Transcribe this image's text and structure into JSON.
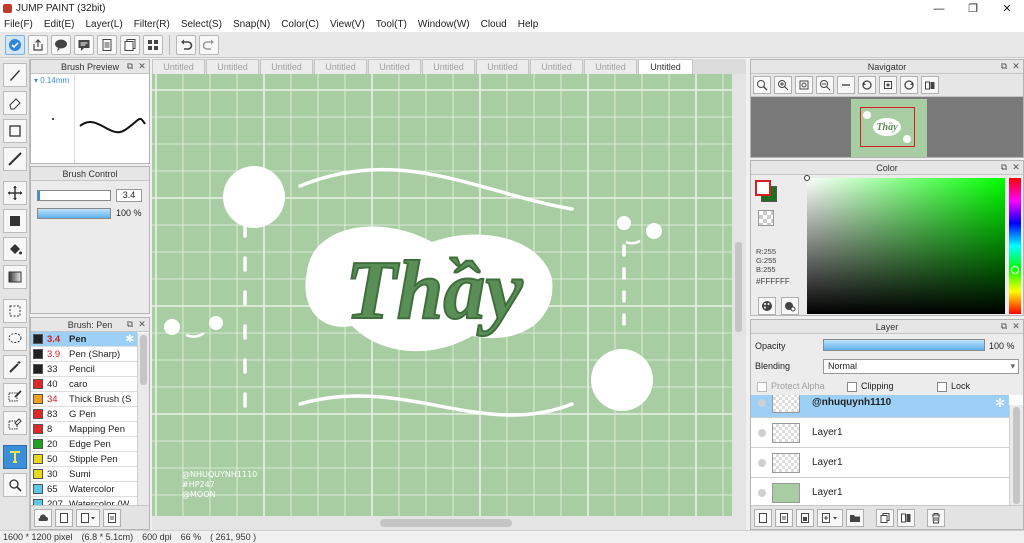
{
  "window": {
    "title": "JUMP PAINT (32bit)",
    "minimize": "—",
    "maximize": "❐",
    "close": "✕"
  },
  "menu": [
    "File(F)",
    "Edit(E)",
    "Layer(L)",
    "Filter(R)",
    "Select(S)",
    "Snap(N)",
    "Color(C)",
    "View(V)",
    "Tool(T)",
    "Window(W)",
    "Cloud",
    "Help"
  ],
  "brush_preview": {
    "title": "Brush Preview",
    "size_label": "0.14mm"
  },
  "brush_control": {
    "title": "Brush Control",
    "size_value": "3.4",
    "opacity_value": "100 %",
    "opacity_fill": 1.0
  },
  "brush_list": {
    "title": "Brush: Pen",
    "items": [
      {
        "size": "3.4",
        "name": "Pen",
        "color": "#222222",
        "size_red": true,
        "selected": true
      },
      {
        "size": "3.9",
        "name": "Pen (Sharp)",
        "color": "#222222",
        "size_red": true,
        "selected": false
      },
      {
        "size": "33",
        "name": "Pencil",
        "color": "#222222",
        "size_red": false,
        "selected": false
      },
      {
        "size": "40",
        "name": "caro",
        "color": "#e02828",
        "size_red": false,
        "selected": false
      },
      {
        "size": "34",
        "name": "Thick Brush (S",
        "color": "#f0a020",
        "size_red": true,
        "selected": false
      },
      {
        "size": "83",
        "name": "G Pen",
        "color": "#e02828",
        "size_red": false,
        "selected": false
      },
      {
        "size": "8",
        "name": "Mapping Pen",
        "color": "#e02828",
        "size_red": false,
        "selected": false
      },
      {
        "size": "20",
        "name": "Edge Pen",
        "color": "#22a022",
        "size_red": false,
        "selected": false
      },
      {
        "size": "50",
        "name": "Stipple Pen",
        "color": "#e8d820",
        "size_red": false,
        "selected": false
      },
      {
        "size": "30",
        "name": "Sumi",
        "color": "#e8d820",
        "size_red": false,
        "selected": false
      },
      {
        "size": "65",
        "name": "Watercolor",
        "color": "#5ac8e8",
        "size_red": false,
        "selected": false
      },
      {
        "size": "207",
        "name": "Watercolor (W",
        "color": "#5ac8e8",
        "size_red": false,
        "selected": false
      }
    ]
  },
  "tabs": [
    "Untitled",
    "Untitled",
    "Untitled",
    "Untitled",
    "Untitled",
    "Untitled",
    "Untitled",
    "Untitled",
    "Untitled",
    "Untitled"
  ],
  "active_tab": 9,
  "canvas": {
    "background": "#a8cda2",
    "main_text": "Thầy",
    "watermark": [
      "@NHUQUYNH1110",
      "#HP247",
      "@MOON"
    ]
  },
  "navigator": {
    "title": "Navigator"
  },
  "color": {
    "title": "Color",
    "r": "R:255",
    "g": "G:255",
    "b": "B:255",
    "hex": "#FFFFFF",
    "main_color": "#ffffff",
    "sub_color": "#1d6f1d"
  },
  "layer": {
    "title": "Layer",
    "opacity_label": "Opacity",
    "opacity_value": "100 %",
    "opacity_fill": 1.0,
    "blending_label": "Blending",
    "blending_value": "Normal",
    "protect_alpha": "Protect Alpha",
    "clipping": "Clipping",
    "lock": "Lock",
    "layers": [
      {
        "name": "@nhuquynh1110",
        "selected": true
      },
      {
        "name": "Layer1",
        "selected": false
      },
      {
        "name": "Layer1",
        "selected": false
      },
      {
        "name": "Layer1",
        "selected": false
      }
    ]
  },
  "status": {
    "size": "1600 * 1200 pixel",
    "physical": "(6.8 * 5.1cm)",
    "dpi": "600 dpi",
    "zoom": "66 %",
    "coords": "( 261, 950 )"
  }
}
